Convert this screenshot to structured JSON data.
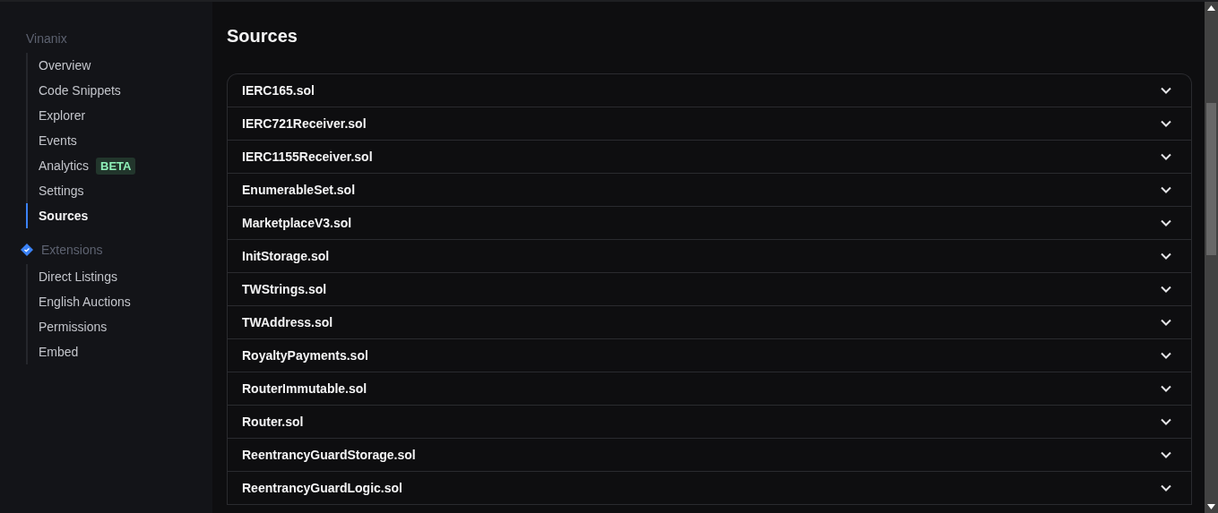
{
  "sidebar": {
    "groups": [
      {
        "title": "Vinanix",
        "icon": false,
        "items": [
          {
            "label": "Overview",
            "selected": false
          },
          {
            "label": "Code Snippets",
            "selected": false
          },
          {
            "label": "Explorer",
            "selected": false
          },
          {
            "label": "Events",
            "selected": false
          },
          {
            "label": "Analytics",
            "selected": false,
            "badge": "BETA"
          },
          {
            "label": "Settings",
            "selected": false
          },
          {
            "label": "Sources",
            "selected": true
          }
        ]
      },
      {
        "title": "Extensions",
        "icon": true,
        "items": [
          {
            "label": "Direct Listings",
            "selected": false
          },
          {
            "label": "English Auctions",
            "selected": false
          },
          {
            "label": "Permissions",
            "selected": false
          },
          {
            "label": "Embed",
            "selected": false
          }
        ]
      }
    ]
  },
  "main": {
    "title": "Sources",
    "sources": [
      {
        "name": "IERC165.sol",
        "expanded": false
      },
      {
        "name": "IERC721Receiver.sol",
        "expanded": false
      },
      {
        "name": "IERC1155Receiver.sol",
        "expanded": false
      },
      {
        "name": "EnumerableSet.sol",
        "expanded": false
      },
      {
        "name": "MarketplaceV3.sol",
        "expanded": false
      },
      {
        "name": "InitStorage.sol",
        "expanded": false
      },
      {
        "name": "TWStrings.sol",
        "expanded": false
      },
      {
        "name": "TWAddress.sol",
        "expanded": false
      },
      {
        "name": "RoyaltyPayments.sol",
        "expanded": false
      },
      {
        "name": "RouterImmutable.sol",
        "expanded": false
      },
      {
        "name": "Router.sol",
        "expanded": false
      },
      {
        "name": "ReentrancyGuardStorage.sol",
        "expanded": false
      },
      {
        "name": "ReentrancyGuardLogic.sol",
        "expanded": false
      }
    ]
  }
}
